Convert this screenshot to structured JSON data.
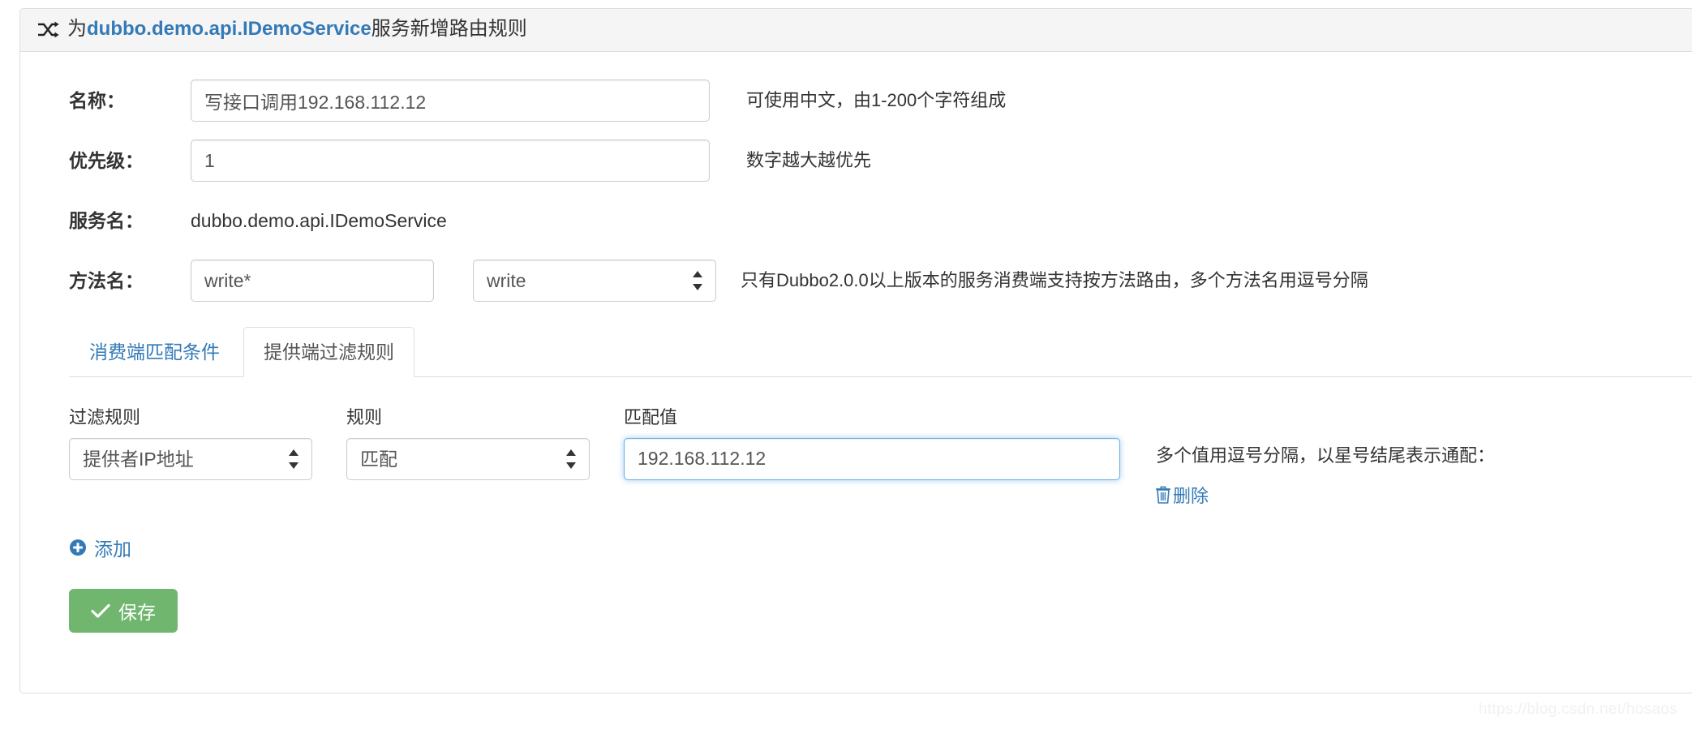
{
  "header": {
    "icon": "shuffle-icon",
    "prefix": "为",
    "service_link": "dubbo.demo.api.IDemoService",
    "suffix": "服务新增路由规则"
  },
  "form": {
    "name": {
      "label": "名称：",
      "value": "写接口调用192.168.112.12",
      "placeholder": "",
      "help": "可使用中文，由1-200个字符组成"
    },
    "priority": {
      "label": "优先级：",
      "value": "1",
      "placeholder": "",
      "help": "数字越大越优先"
    },
    "service": {
      "label": "服务名：",
      "value": "dubbo.demo.api.IDemoService"
    },
    "method": {
      "label": "方法名：",
      "value": "write*",
      "placeholder": "",
      "select_value": "write",
      "select_options": [
        "write"
      ],
      "help": "只有Dubbo2.0.0以上版本的服务消费端支持按方法路由，多个方法名用逗号分隔"
    }
  },
  "tabs": [
    {
      "label": "消费端匹配条件",
      "active": false
    },
    {
      "label": "提供端过滤规则",
      "active": true
    }
  ],
  "filter": {
    "columns": {
      "rule": "过滤规则",
      "operator": "规则",
      "value": "匹配值"
    },
    "rows": [
      {
        "rule_value": "提供者IP地址",
        "rule_options": [
          "提供者IP地址"
        ],
        "operator_value": "匹配",
        "operator_options": [
          "匹配"
        ],
        "match_value": "192.168.112.12",
        "match_placeholder": "",
        "note": "多个值用逗号分隔，以星号结尾表示通配：",
        "delete_label": "删除",
        "delete_icon": "trash-icon"
      }
    ],
    "add": {
      "label": "添加",
      "icon": "plus-circle-icon"
    }
  },
  "actions": {
    "save": {
      "label": "保存",
      "icon": "check-icon"
    }
  },
  "colors": {
    "link": "#337ab7",
    "save_button": "#70b66f",
    "focus_border": "#66afe9",
    "panel_header_bg": "#f5f5f5",
    "border": "#dddddd"
  },
  "watermark": "https://blog.csdn.net/hosaos"
}
